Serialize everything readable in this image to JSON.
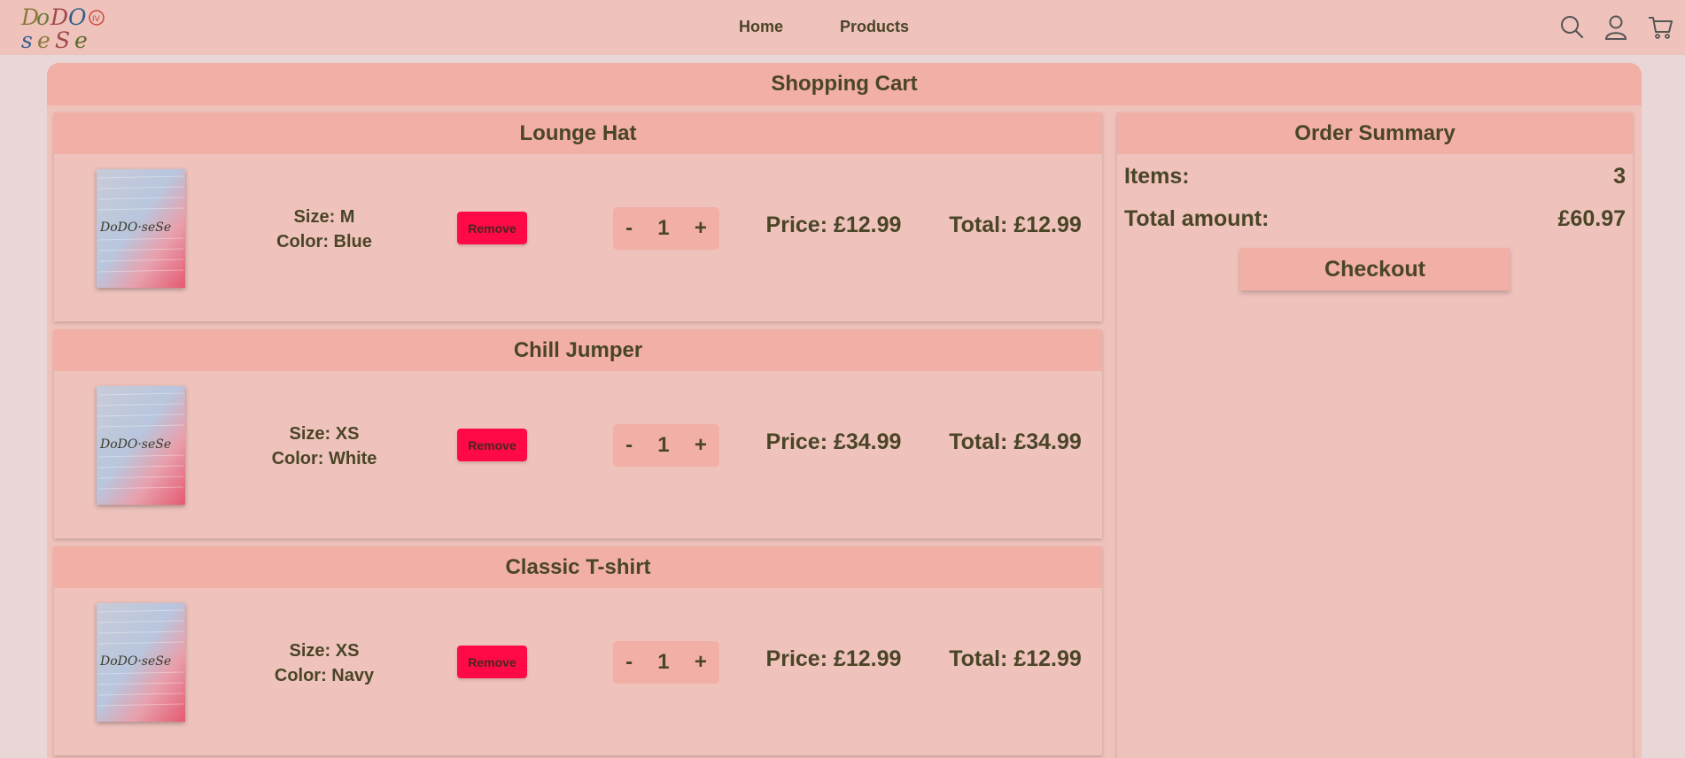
{
  "brand": {
    "logo_top": "DoDO",
    "logo_bottom": "seSe",
    "logo_badge": "IV"
  },
  "nav": {
    "home": "Home",
    "products": "Products"
  },
  "header_icons": [
    "search-icon",
    "user-icon",
    "cart-icon"
  ],
  "cart": {
    "title": "Shopping Cart",
    "remove_label": "Remove",
    "minus": "-",
    "plus": "+",
    "items": [
      {
        "name": "Lounge Hat",
        "size": "Size: M",
        "color": "Color: Blue",
        "quantity": "1",
        "price": "Price: £12.99",
        "total": "Total: £12.99",
        "thumb_label": "DoDO·seSe"
      },
      {
        "name": "Chill Jumper",
        "size": "Size: XS",
        "color": "Color: White",
        "quantity": "1",
        "price": "Price: £34.99",
        "total": "Total: £34.99",
        "thumb_label": "DoDO·seSe"
      },
      {
        "name": "Classic T-shirt",
        "size": "Size: XS",
        "color": "Color: Navy",
        "quantity": "1",
        "price": "Price: £12.99",
        "total": "Total: £12.99",
        "thumb_label": "DoDO·seSe"
      }
    ]
  },
  "summary": {
    "title": "Order Summary",
    "items_label": "Items:",
    "items_value": "3",
    "amount_label": "Total amount:",
    "amount_value": "£60.97",
    "checkout_label": "Checkout"
  },
  "colors": {
    "background": "#e9d6d6",
    "panel": "#efc2bc",
    "header": "#f2afa5",
    "text": "#4a4527",
    "remove": "#ff0a47"
  }
}
